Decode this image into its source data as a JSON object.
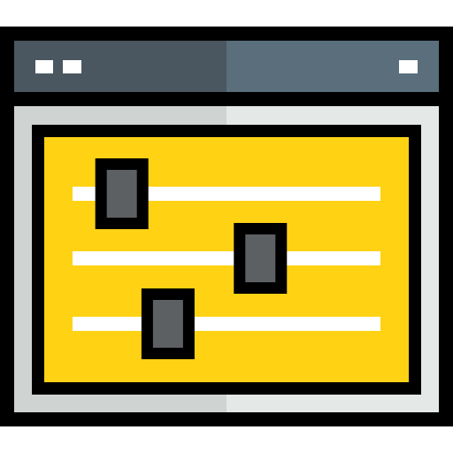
{
  "icon": {
    "name": "browser-window-equalizer-icon",
    "colors": {
      "outline": "#000000",
      "titlebar_left": "#4a5761",
      "titlebar_right": "#5a6e7b",
      "titlebar_dots": "#ffffff",
      "frame_left": "#cfd3d2",
      "frame_right": "#e4e9e8",
      "panel": "#ffd214",
      "track": "#ffffff",
      "knob_inner": "#5d6063"
    },
    "sliders": [
      {
        "name": "slider-1",
        "value": 0.16
      },
      {
        "name": "slider-2",
        "value": 0.61
      },
      {
        "name": "slider-3",
        "value": 0.31
      }
    ]
  }
}
